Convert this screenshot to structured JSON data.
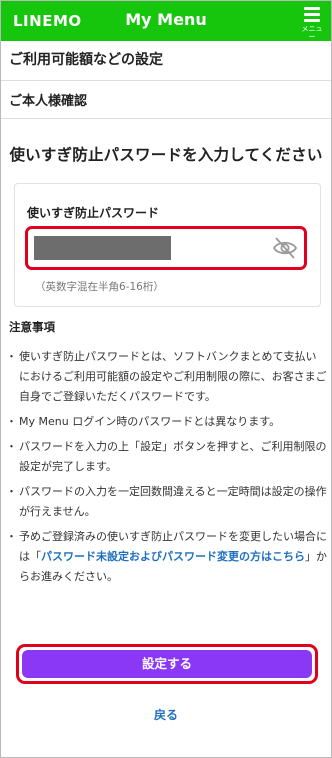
{
  "header": {
    "logo": "LINEMO",
    "title": "My Menu",
    "menu_label": "メニュー",
    "menu_icon": "hamburger-icon",
    "background": "#16c60c"
  },
  "page": {
    "section_title": "ご利用可能額などの設定",
    "sub_section_title": "ご本人様確認",
    "heading": "使いすぎ防止パスワードを入力してください"
  },
  "form": {
    "password_label": "使いすぎ防止パスワード",
    "password_hint": "（英数字混在半角6-16桁）",
    "visibility_icon": "eye-off-icon"
  },
  "notes": {
    "title": "注意事項",
    "items": [
      "使いすぎ防止パスワードとは、ソフトバンクまとめて支払いにおけるご利用可能額の設定やご利用制限の際に、お客さまご自身でご登録いただくパスワードです。",
      "My Menu ログイン時のパスワードとは異なります。",
      "パスワードを入力の上「設定」ボタンを押すと、ご利用制限の設定が完了します。",
      "パスワードの入力を一定回数間違えると一定時間は設定の操作が行えません。"
    ],
    "last_item_prefix": "予めご登録済みの使いすぎ防止パスワードを変更したい場合には「",
    "last_item_link": "パスワード未設定およびパスワード変更の方はこちら",
    "last_item_suffix": "」からお進みください。"
  },
  "actions": {
    "submit_label": "設定する",
    "back_label": "戻る",
    "submit_color": "#8a38f5",
    "highlight_color": "#e0001b",
    "link_color": "#1f6fbf"
  }
}
